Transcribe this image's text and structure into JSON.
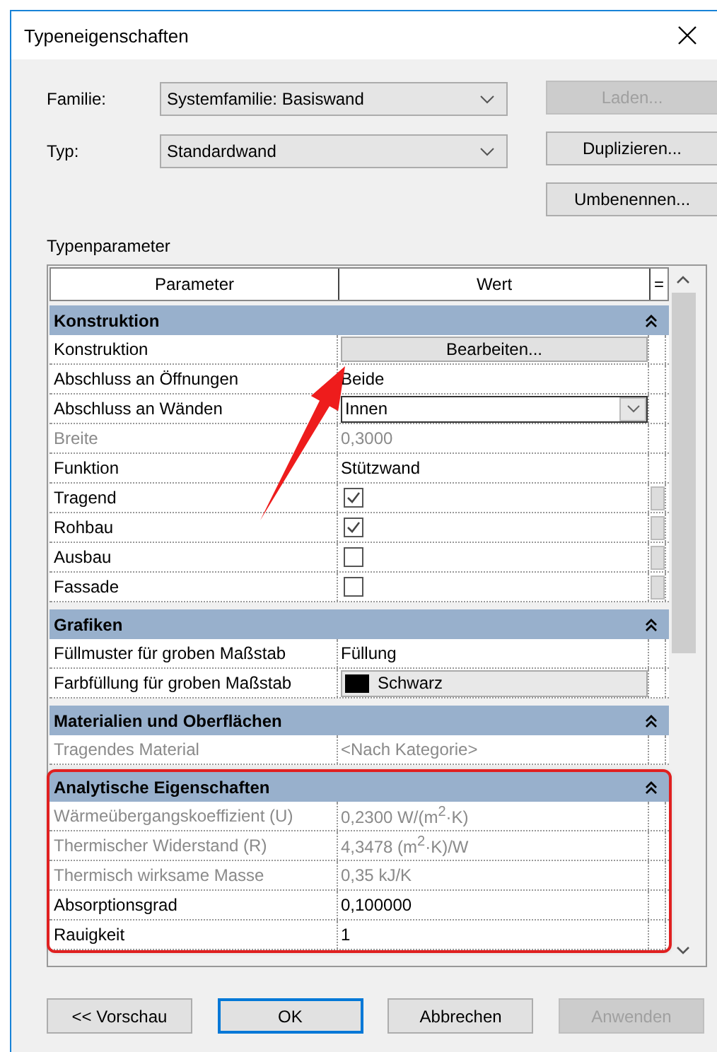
{
  "window": {
    "title": "Typeneigenschaften"
  },
  "family": {
    "label": "Familie:",
    "value": "Systemfamilie: Basiswand"
  },
  "type": {
    "label": "Typ:",
    "value": "Standardwand"
  },
  "side_buttons": [
    {
      "label": "Laden...",
      "disabled": true
    },
    {
      "label": "Duplizieren...",
      "disabled": false
    },
    {
      "label": "Umbenennen...",
      "disabled": false
    }
  ],
  "table": {
    "title": "Typenparameter",
    "columns": [
      "Parameter",
      "Wert",
      "="
    ],
    "sections": [
      {
        "title": "Konstruktion",
        "expanded": true,
        "highlighted": false,
        "rows": [
          {
            "kind": "button",
            "name": "Konstruktion",
            "value": "Bearbeiten...",
            "disabled": false,
            "link_button": false
          },
          {
            "kind": "text",
            "name": "Abschluss an Öffnungen",
            "value": "Beide",
            "disabled": false,
            "link_button": false
          },
          {
            "kind": "dropdown",
            "name": "Abschluss an Wänden",
            "value": "Innen",
            "disabled": false,
            "link_button": false
          },
          {
            "kind": "text",
            "name": "Breite",
            "value": "0,3000",
            "disabled": true,
            "link_button": false
          },
          {
            "kind": "text",
            "name": "Funktion",
            "value": "Stützwand",
            "disabled": false,
            "link_button": false
          },
          {
            "kind": "checkbox",
            "name": "Tragend",
            "checked": true,
            "disabled": false,
            "link_button": true
          },
          {
            "kind": "checkbox",
            "name": "Rohbau",
            "checked": true,
            "disabled": false,
            "link_button": true
          },
          {
            "kind": "checkbox",
            "name": "Ausbau",
            "checked": false,
            "disabled": false,
            "link_button": true
          },
          {
            "kind": "checkbox",
            "name": "Fassade",
            "checked": false,
            "disabled": false,
            "link_button": true
          }
        ]
      },
      {
        "title": "Grafiken",
        "expanded": true,
        "highlighted": false,
        "rows": [
          {
            "kind": "text",
            "name": "Füllmuster für groben Maßstab",
            "value": "Füllung",
            "disabled": false,
            "link_button": false
          },
          {
            "kind": "color",
            "name": "Farbfüllung für groben Maßstab",
            "value": "Schwarz",
            "color": "#000000",
            "disabled": false,
            "link_button": false
          }
        ]
      },
      {
        "title": "Materialien und Oberflächen",
        "expanded": true,
        "highlighted": false,
        "rows": [
          {
            "kind": "text",
            "name": "Tragendes Material",
            "value": "<Nach Kategorie>",
            "disabled": true,
            "link_button": false
          }
        ]
      },
      {
        "title": "Analytische Eigenschaften",
        "expanded": true,
        "highlighted": true,
        "rows": [
          {
            "kind": "text",
            "name": "Wärmeübergangskoeffizient (U)",
            "value": "0,2300 W/(m$^{2}$·K)",
            "disabled": true,
            "link_button": false
          },
          {
            "kind": "text",
            "name": "Thermischer Widerstand (R)",
            "value": "4,3478 (m$^{2}$·K)/W",
            "disabled": true,
            "link_button": false
          },
          {
            "kind": "text",
            "name": "Thermisch wirksame Masse",
            "value": "0,35 kJ/K",
            "disabled": true,
            "link_button": false
          },
          {
            "kind": "text",
            "name": "Absorptionsgrad",
            "value": "0,100000",
            "disabled": false,
            "link_button": false
          },
          {
            "kind": "text",
            "name": "Rauigkeit",
            "value": "1",
            "disabled": false,
            "link_button": false
          }
        ]
      }
    ]
  },
  "footer_buttons": [
    {
      "label": "<< Vorschau",
      "disabled": false,
      "default": false
    },
    {
      "label": "OK",
      "disabled": false,
      "default": true
    },
    {
      "label": "Abbrechen",
      "disabled": false,
      "default": false
    },
    {
      "label": "Anwenden",
      "disabled": true,
      "default": false
    }
  ]
}
